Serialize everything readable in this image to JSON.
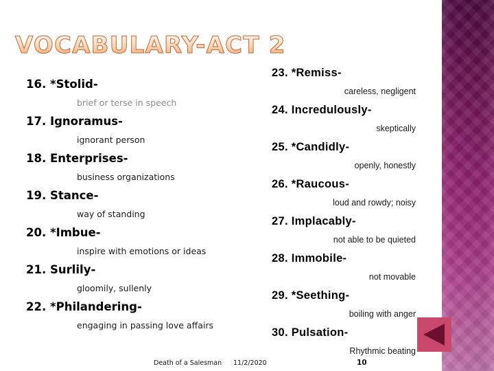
{
  "slide": {
    "title": "VOCABULARY-ACT 2",
    "title_gradient_top": "#ffffff",
    "title_gradient_bottom": "#e9a070",
    "title_outline_color": "#c06a34",
    "background_color": "#ffffff",
    "accent_band_top_color": "#4e0b3f",
    "accent_band_bottom_color": "#bd74a8"
  },
  "left_column": {
    "entries": [
      {
        "term": "16.  *Stolid-",
        "definition": "brief or terse in speech",
        "definition_muted": true
      },
      {
        "term": "17. Ignoramus-",
        "definition": "ignorant person",
        "definition_muted": false
      },
      {
        "term": "18. Enterprises-",
        "definition": "business organizations",
        "definition_muted": false
      },
      {
        "term": "19. Stance-",
        "definition": "way of standing",
        "definition_muted": false
      },
      {
        "term": "20. *Imbue-",
        "definition": "inspire with emotions or ideas",
        "definition_muted": false
      },
      {
        "term": "21.  Surlily-",
        "definition": "gloomily, sullenly",
        "definition_muted": false
      },
      {
        "term": "22.  *Philandering-",
        "definition": "engaging in passing love affairs",
        "definition_muted": false
      }
    ]
  },
  "right_column": {
    "entries": [
      {
        "term": "23. *Remiss-",
        "definition": "careless, negligent"
      },
      {
        "term": "24.  Incredulously-",
        "definition": "skeptically"
      },
      {
        "term": "25. *Candidly-",
        "definition": "openly, honestly"
      },
      {
        "term": "26. *Raucous-",
        "definition": "loud and rowdy; noisy"
      },
      {
        "term": "27.  Implacably-",
        "definition": "not able to be quieted"
      },
      {
        "term": "28.  Immobile-",
        "definition": "not movable"
      },
      {
        "term": "29. *Seething-",
        "definition": "boiling with anger"
      },
      {
        "term": "30.  Pulsation-",
        "definition": "Rhythmic beating"
      }
    ]
  },
  "navigation": {
    "back_button_label": "◀",
    "back_button_color": "#c8486b",
    "back_arrow_color": "#6d1030"
  },
  "footer": {
    "source": "Death of a Salesman",
    "date": "11/2/2020",
    "page_number": "10"
  }
}
